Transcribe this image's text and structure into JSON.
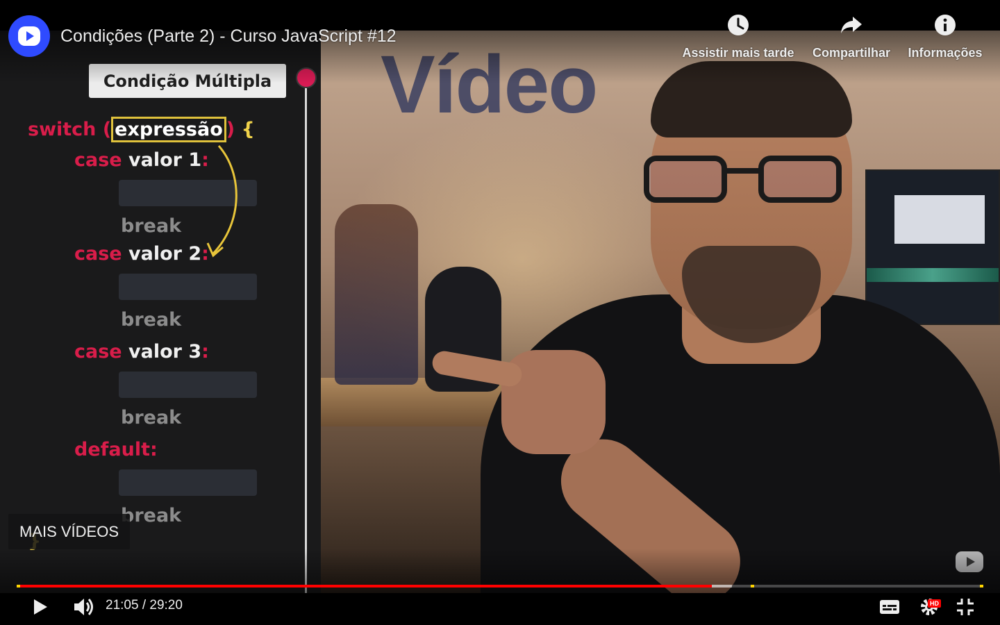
{
  "header": {
    "title": "Condições (Parte 2) - Curso JavaScript #12",
    "actions": [
      {
        "label": "Assistir mais tarde",
        "icon": "clock-icon"
      },
      {
        "label": "Compartilhar",
        "icon": "share-arrow-icon"
      },
      {
        "label": "Informações",
        "icon": "info-icon"
      }
    ]
  },
  "video_overlay": {
    "wall_sign": "Vídeo",
    "panel_title": "Condição Múltipla",
    "code": {
      "switch_kw": "switch",
      "open_paren": "(",
      "expression": "expressão",
      "close_paren": ")",
      "open_brace": "{",
      "cases": [
        {
          "kw": "case",
          "value": "valor 1",
          "colon": ":",
          "break": "break"
        },
        {
          "kw": "case",
          "value": "valor 2",
          "colon": ":",
          "break": "break"
        },
        {
          "kw": "case",
          "value": "valor 3",
          "colon": ":",
          "break": "break"
        }
      ],
      "default_kw": "default:",
      "default_break": "break",
      "close_brace": "}"
    }
  },
  "more_videos": {
    "label": "MAIS VÍDEOS"
  },
  "controls": {
    "time": "21:05 / 29:20",
    "progress_played_fraction": 0.719,
    "progress_buffer_fraction": 0.74,
    "hd_badge": "HD",
    "colors": {
      "progress": "#ff0000",
      "chapter_marker": "#ffd400",
      "accent": "#2f4bff"
    }
  }
}
